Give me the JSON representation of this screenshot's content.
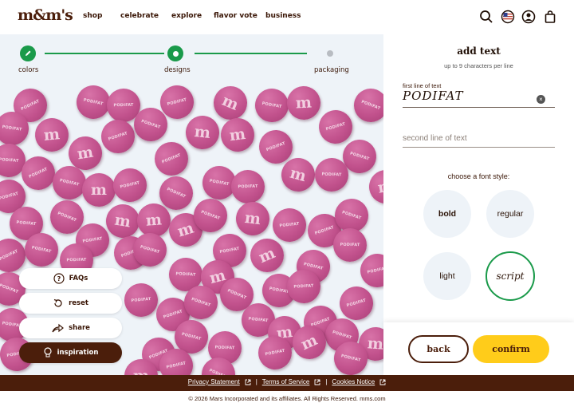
{
  "header": {
    "logo": "m&m's",
    "nav": [
      "shop",
      "celebrate",
      "explore",
      "flavor vote",
      "business"
    ]
  },
  "stepper": {
    "steps": [
      "colors",
      "designs",
      "packaging"
    ]
  },
  "candy": {
    "print_text": "PODIFAT",
    "color": "#c2528d"
  },
  "floating_buttons": {
    "faqs": "FAQs",
    "reset": "reset",
    "share": "share",
    "inspiration": "inspiration"
  },
  "panel": {
    "title": "add text",
    "subtitle": "up to 9 characters per line",
    "first_line_label": "first line of text",
    "first_line_value": "PODIFAT",
    "second_line_placeholder": "second line of text",
    "font_style_title": "choose a font style:",
    "font_styles": [
      "bold",
      "regular",
      "light",
      "script"
    ],
    "selected_style": "script"
  },
  "actions": {
    "back": "back",
    "confirm": "confirm"
  },
  "footer": {
    "links": [
      "Privacy Statement",
      "Terms of Service",
      "Cookies Notice"
    ],
    "separator": "|",
    "copyright": "© 2026 Mars Incorporated and its affiliates. All Rights Reserved. mms.com"
  },
  "colors": {
    "brand_brown": "#4b1e0b",
    "accent_green": "#1a9a4a",
    "confirm_yellow": "#ffcc1a"
  }
}
